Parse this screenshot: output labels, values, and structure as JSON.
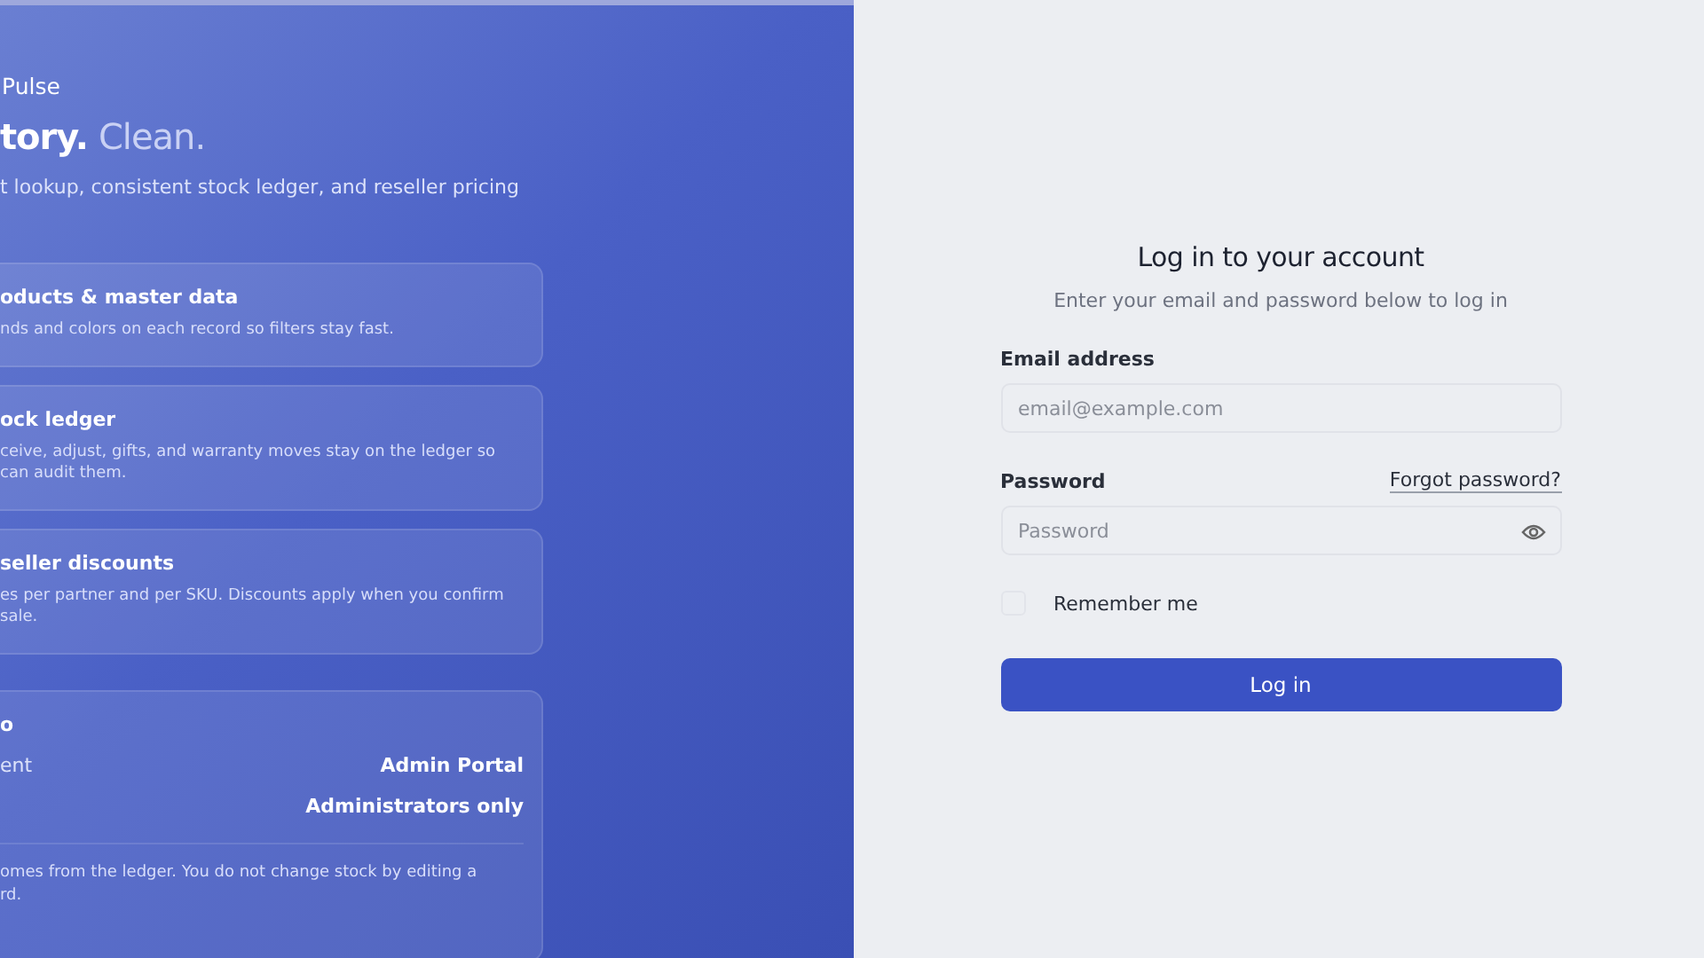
{
  "brand": {
    "name": "Pulse"
  },
  "hero": {
    "heading": "tory.",
    "heading_accent": "Clean.",
    "subtitle": "t lookup, consistent stock ledger, and reseller pricing"
  },
  "features": [
    {
      "title": "oducts & master data",
      "text": "nds and colors on each record so filters stay fast."
    },
    {
      "title": "ock ledger",
      "text": "ceive, adjust, gifts, and warranty moves stay on the ledger so\n can audit them."
    },
    {
      "title": "seller discounts",
      "text": "es per partner and per SKU. Discounts apply when you confirm\n sale."
    }
  ],
  "info_card": {
    "title": "o",
    "rows": [
      {
        "label": "ent",
        "value": "Admin Portal"
      },
      {
        "value": "Administrators only"
      }
    ],
    "note": "omes from the ledger. You do not change stock by editing a\nrd."
  },
  "login": {
    "title": "Log in to your account",
    "subtitle": "Enter your email and password below to log in",
    "email": {
      "label": "Email address",
      "placeholder": "email@example.com"
    },
    "password": {
      "label": "Password",
      "placeholder": "Password",
      "forgot": "Forgot password?"
    },
    "remember": {
      "label": "Remember me",
      "checked": false
    },
    "submit": "Log in"
  }
}
